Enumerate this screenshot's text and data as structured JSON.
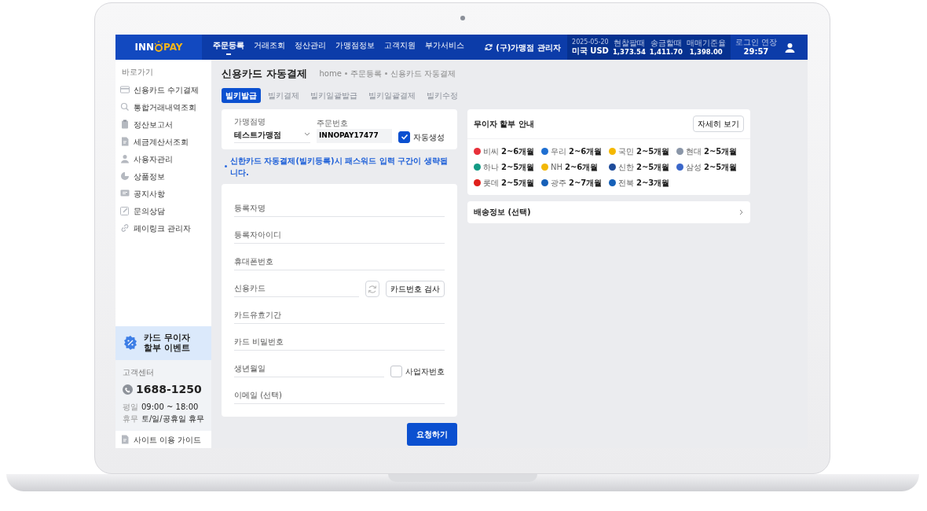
{
  "header": {
    "logo": {
      "left": "INN",
      "right": "PAY"
    },
    "nav": [
      {
        "label": "주문등록",
        "selected": true
      },
      {
        "label": "거래조회",
        "selected": false
      },
      {
        "label": "정산관리",
        "selected": false
      },
      {
        "label": "가맹점정보",
        "selected": false
      },
      {
        "label": "고객지원",
        "selected": false
      },
      {
        "label": "부가서비스",
        "selected": false
      }
    ],
    "account": "(구)가맹점 관리자",
    "rates": {
      "date": "2025-05-20",
      "currency": "미국 USD",
      "columns": [
        {
          "label": "현찰팔때",
          "value": "1,373.54"
        },
        {
          "label": "송금할때",
          "value": "1,411.70"
        },
        {
          "label": "매매기준율",
          "value": "1,398.00"
        }
      ]
    },
    "session": {
      "label": "로그인 연장",
      "time": "29:57"
    }
  },
  "sidebar": {
    "heading": "바로가기",
    "items": [
      {
        "label": "신용카드 수기결제"
      },
      {
        "label": "통합거래내역조회"
      },
      {
        "label": "정산보고서"
      },
      {
        "label": "세금계산서조회"
      },
      {
        "label": "사용자관리"
      },
      {
        "label": "상품정보"
      },
      {
        "label": "공지사항"
      },
      {
        "label": "문의상담"
      },
      {
        "label": "페이링크 관리자"
      }
    ],
    "promo": [
      "카드 무이자",
      "할부 이벤트"
    ],
    "support": {
      "label": "고객센터",
      "phone": "1688-1250",
      "hours": [
        {
          "label": "평일",
          "value": "09:00 ~ 18:00"
        },
        {
          "label": "휴무",
          "value": "토/일/공휴일 휴무"
        }
      ]
    },
    "guide": "사이트 이용 가이드"
  },
  "page": {
    "title": "신용카드 자동결제",
    "breadcrumb": [
      "home",
      "주문등록",
      "신용카드 자동결제"
    ],
    "tabs": [
      {
        "label": "빌키발급",
        "selected": true
      },
      {
        "label": "빌키결제",
        "selected": false
      },
      {
        "label": "빌키일괄발급",
        "selected": false
      },
      {
        "label": "빌키일괄결제",
        "selected": false
      },
      {
        "label": "빌키수정",
        "selected": false
      }
    ],
    "merchant": {
      "label": "가맹점명",
      "value": "테스트가맹점"
    },
    "order": {
      "label": "주문번호",
      "value": "INNOPAY17477",
      "auto": {
        "label": "자동생성",
        "checked": true
      }
    },
    "notice": "신한카드 자동결제(빌키등록)시 패스워드 입력 구간이 생략됩니다.",
    "fields": [
      {
        "kind": "text",
        "placeholder": "등록자명"
      },
      {
        "kind": "text",
        "placeholder": "등록자아이디"
      },
      {
        "kind": "text",
        "placeholder": "휴대폰번호"
      },
      {
        "kind": "card",
        "placeholder": "신용카드",
        "button": "카드번호 검사"
      },
      {
        "kind": "text",
        "placeholder": "카드유효기간"
      },
      {
        "kind": "text",
        "placeholder": "카드 비밀번호"
      },
      {
        "kind": "birth",
        "placeholder": "생년월일",
        "option": {
          "label": "사업자번호",
          "checked": false
        }
      },
      {
        "kind": "text",
        "placeholder": "이메일 (선택)"
      }
    ],
    "submit": "요청하기",
    "installment": {
      "title": "무이자 할부 안내",
      "button": "자세히 보기",
      "banks": [
        {
          "name": "비씨",
          "months": "2~6개월",
          "color": "#e8303a"
        },
        {
          "name": "우리",
          "months": "2~6개월",
          "color": "#1f6fd1"
        },
        {
          "name": "국민",
          "months": "2~5개월",
          "color": "#f5b800"
        },
        {
          "name": "현대",
          "months": "2~5개월",
          "color": "#8a96a8"
        },
        {
          "name": "하나",
          "months": "2~5개월",
          "color": "#139a84"
        },
        {
          "name": "NH",
          "months": "2~6개월",
          "color": "#f2b705"
        },
        {
          "name": "신한",
          "months": "2~5개월",
          "color": "#1d4b9a"
        },
        {
          "name": "삼성",
          "months": "2~5개월",
          "color": "#3a66c9"
        },
        {
          "name": "롯데",
          "months": "2~5개월",
          "color": "#e0201b"
        },
        {
          "name": "광주",
          "months": "2~7개월",
          "color": "#1660b8"
        },
        {
          "name": "전북",
          "months": "2~3개월",
          "color": "#1660b8"
        }
      ]
    },
    "shipping": "배송정보 (선택)"
  }
}
